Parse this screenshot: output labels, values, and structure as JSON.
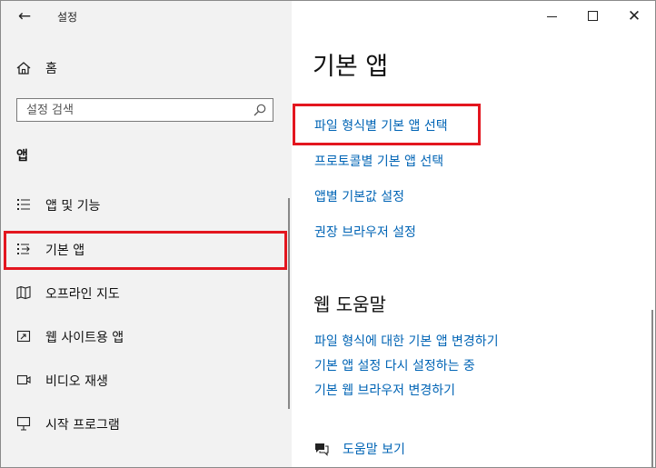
{
  "window": {
    "title": "설정"
  },
  "sidebar": {
    "home_label": "홈",
    "search_placeholder": "설정 검색",
    "section_label": "앱",
    "items": [
      {
        "label": "앱 및 기능",
        "icon": "apps-list-icon"
      },
      {
        "label": "기본 앱",
        "icon": "default-apps-icon",
        "selected": true
      },
      {
        "label": "오프라인 지도",
        "icon": "map-icon"
      },
      {
        "label": "웹 사이트용 앱",
        "icon": "website-apps-icon"
      },
      {
        "label": "비디오 재생",
        "icon": "video-icon"
      },
      {
        "label": "시작 프로그램",
        "icon": "startup-icon"
      }
    ]
  },
  "main": {
    "title": "기본 앱",
    "links": [
      "파일 형식별 기본 앱 선택",
      "프로토콜별 기본 앱 선택",
      "앱별 기본값 설정",
      "권장 브라우저 설정"
    ],
    "help_section_title": "웹 도움말",
    "help_links": [
      "파일 형식에 대한 기본 앱 변경하기",
      "기본 앱 설정 다시 설정하는 중",
      "기본 웹 브라우저 변경하기"
    ],
    "get_help_label": "도움말 보기"
  },
  "colors": {
    "accent_link": "#0064b5",
    "highlight": "#e3161f",
    "sidebar_bg": "#f2f2f2"
  }
}
